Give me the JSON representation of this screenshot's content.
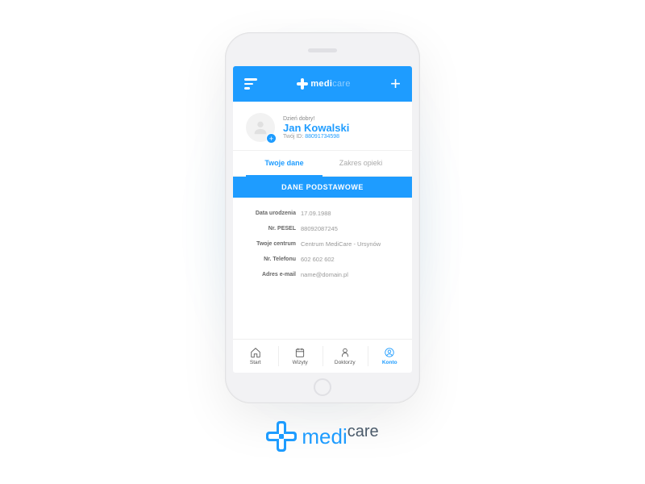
{
  "header": {
    "brand_medi": "medi",
    "brand_care": "care"
  },
  "profile": {
    "greeting": "Dzień dobry!",
    "name": "Jan Kowalski",
    "id_label": "Twój ID:",
    "id_value": "88091734598"
  },
  "tabs": [
    {
      "label": "Twoje dane",
      "active": true
    },
    {
      "label": "Zakres opieki",
      "active": false
    }
  ],
  "section_title": "DANE PODSTAWOWE",
  "rows": [
    {
      "label": "Data urodzenia",
      "value": "17.09.1988"
    },
    {
      "label": "Nr. PESEL",
      "value": "88092087245"
    },
    {
      "label": "Twoje centrum",
      "value": "Centrum MediCare - Ursynów"
    },
    {
      "label": "Nr. Telefonu",
      "value": "602 602 602"
    },
    {
      "label": "Adres e-mail",
      "value": "name@domain.pl"
    }
  ],
  "nav": [
    {
      "label": "Start"
    },
    {
      "label": "Wizyty"
    },
    {
      "label": "Doktorzy"
    },
    {
      "label": "Konto"
    }
  ],
  "brand": {
    "medi": "medi",
    "care": "care"
  }
}
